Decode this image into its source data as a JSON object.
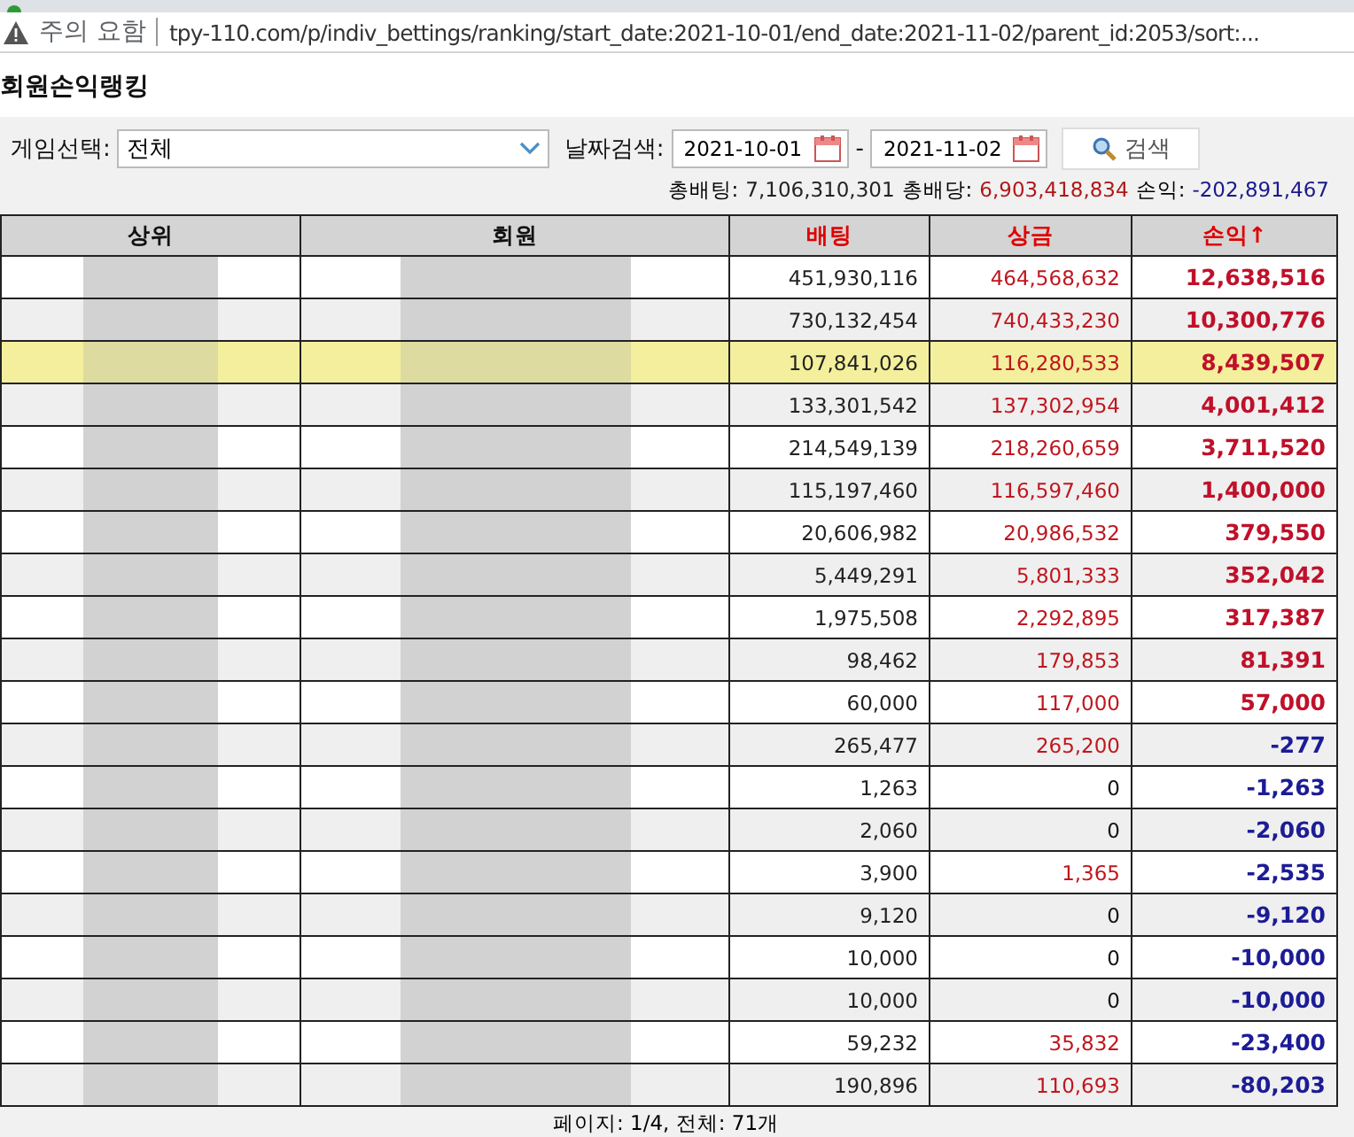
{
  "address_bar": {
    "security": "주의 요함",
    "url": "tpy-110.com/p/indiv_bettings/ranking/start_date:2021-10-01/end_date:2021-11-02/parent_id:2053/sort:..."
  },
  "page_title": "회원손익랭킹",
  "filters": {
    "game_label": "게임선택:",
    "game_value": "전체",
    "date_label": "날짜검색:",
    "start_date": "2021-10-01",
    "separator": "-",
    "end_date": "2021-11-02",
    "search_button": "검색"
  },
  "totals": [
    {
      "label": "총배팅:",
      "value": "7,106,310,301",
      "color": "#222222"
    },
    {
      "label": "총배당:",
      "value": "6,903,418,834",
      "color": "#b01818"
    },
    {
      "label": "손익:",
      "value": "-202,891,467",
      "color": "#1a1a8c"
    }
  ],
  "table": {
    "columns": [
      {
        "label": "상위",
        "color": "#111111"
      },
      {
        "label": "회원",
        "color": "#111111"
      },
      {
        "label": "배팅",
        "color": "#e00000"
      },
      {
        "label": "상금",
        "color": "#e00000"
      },
      {
        "label": "손익↑",
        "color": "#e00000"
      }
    ],
    "rows": [
      {
        "highlighted": false,
        "bet": "451,930,116",
        "prize": {
          "text": "464,568,632",
          "color": "#c0161e"
        },
        "profit": {
          "text": "12,638,516",
          "color": "#c0102a"
        }
      },
      {
        "highlighted": false,
        "bet": "730,132,454",
        "prize": {
          "text": "740,433,230",
          "color": "#c0161e"
        },
        "profit": {
          "text": "10,300,776",
          "color": "#c0102a"
        }
      },
      {
        "highlighted": true,
        "bet": "107,841,026",
        "prize": {
          "text": "116,280,533",
          "color": "#c0161e"
        },
        "profit": {
          "text": "8,439,507",
          "color": "#c0102a"
        }
      },
      {
        "highlighted": false,
        "bet": "133,301,542",
        "prize": {
          "text": "137,302,954",
          "color": "#c0161e"
        },
        "profit": {
          "text": "4,001,412",
          "color": "#c0102a"
        }
      },
      {
        "highlighted": false,
        "bet": "214,549,139",
        "prize": {
          "text": "218,260,659",
          "color": "#c0161e"
        },
        "profit": {
          "text": "3,711,520",
          "color": "#c0102a"
        }
      },
      {
        "highlighted": false,
        "bet": "115,197,460",
        "prize": {
          "text": "116,597,460",
          "color": "#c0161e"
        },
        "profit": {
          "text": "1,400,000",
          "color": "#c0102a"
        }
      },
      {
        "highlighted": false,
        "bet": "20,606,982",
        "prize": {
          "text": "20,986,532",
          "color": "#c0161e"
        },
        "profit": {
          "text": "379,550",
          "color": "#c0102a"
        }
      },
      {
        "highlighted": false,
        "bet": "5,449,291",
        "prize": {
          "text": "5,801,333",
          "color": "#c0161e"
        },
        "profit": {
          "text": "352,042",
          "color": "#c0102a"
        }
      },
      {
        "highlighted": false,
        "bet": "1,975,508",
        "prize": {
          "text": "2,292,895",
          "color": "#c0161e"
        },
        "profit": {
          "text": "317,387",
          "color": "#c0102a"
        }
      },
      {
        "highlighted": false,
        "bet": "98,462",
        "prize": {
          "text": "179,853",
          "color": "#c0161e"
        },
        "profit": {
          "text": "81,391",
          "color": "#c0102a"
        }
      },
      {
        "highlighted": false,
        "bet": "60,000",
        "prize": {
          "text": "117,000",
          "color": "#c0161e"
        },
        "profit": {
          "text": "57,000",
          "color": "#c0102a"
        }
      },
      {
        "highlighted": false,
        "bet": "265,477",
        "prize": {
          "text": "265,200",
          "color": "#c0161e"
        },
        "profit": {
          "text": "-277",
          "color": "#1c1c96"
        }
      },
      {
        "highlighted": false,
        "bet": "1,263",
        "prize": {
          "text": "0",
          "color": "#111111"
        },
        "profit": {
          "text": "-1,263",
          "color": "#1c1c96"
        }
      },
      {
        "highlighted": false,
        "bet": "2,060",
        "prize": {
          "text": "0",
          "color": "#111111"
        },
        "profit": {
          "text": "-2,060",
          "color": "#1c1c96"
        }
      },
      {
        "highlighted": false,
        "bet": "3,900",
        "prize": {
          "text": "1,365",
          "color": "#c0161e"
        },
        "profit": {
          "text": "-2,535",
          "color": "#1c1c96"
        }
      },
      {
        "highlighted": false,
        "bet": "9,120",
        "prize": {
          "text": "0",
          "color": "#111111"
        },
        "profit": {
          "text": "-9,120",
          "color": "#1c1c96"
        }
      },
      {
        "highlighted": false,
        "bet": "10,000",
        "prize": {
          "text": "0",
          "color": "#111111"
        },
        "profit": {
          "text": "-10,000",
          "color": "#1c1c96"
        }
      },
      {
        "highlighted": false,
        "bet": "10,000",
        "prize": {
          "text": "0",
          "color": "#111111"
        },
        "profit": {
          "text": "-10,000",
          "color": "#1c1c96"
        }
      },
      {
        "highlighted": false,
        "bet": "59,232",
        "prize": {
          "text": "35,832",
          "color": "#c0161e"
        },
        "profit": {
          "text": "-23,400",
          "color": "#1c1c96"
        }
      },
      {
        "highlighted": false,
        "bet": "190,896",
        "prize": {
          "text": "110,693",
          "color": "#c0161e"
        },
        "profit": {
          "text": "-80,203",
          "color": "#1c1c96"
        }
      }
    ]
  },
  "footer": "페이지: 1/4, 전체: 71개"
}
